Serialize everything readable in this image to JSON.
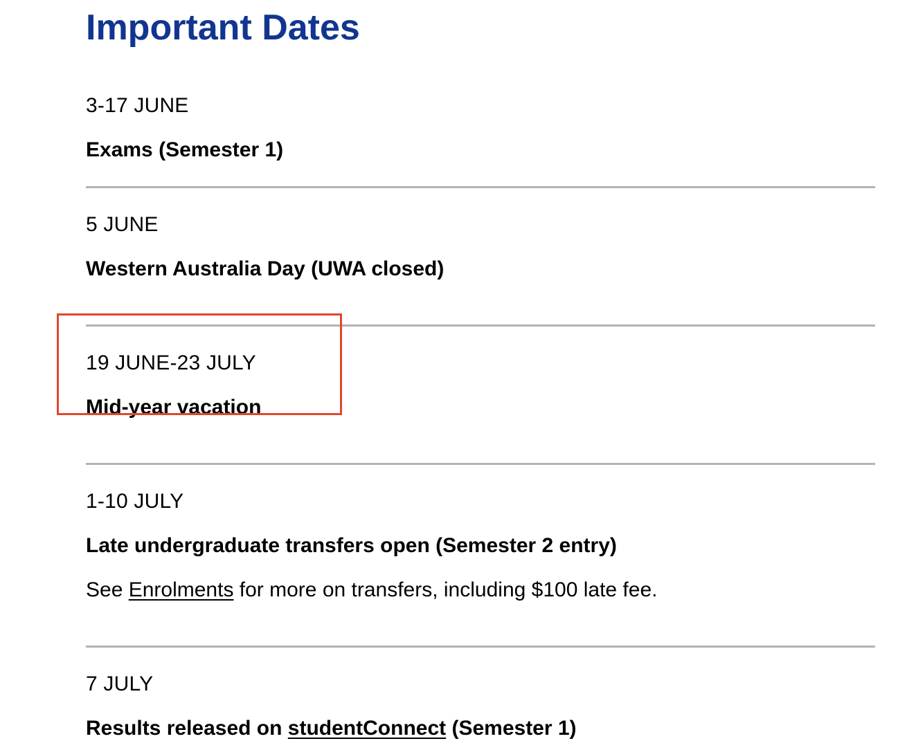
{
  "page": {
    "title": "Important Dates",
    "title_color": "#123590",
    "divider_color": "#b3b3b3",
    "highlight_color": "#e0472f"
  },
  "entries": [
    {
      "date": "3-17 JUNE",
      "event": "Exams (Semester 1)"
    },
    {
      "date": "5 JUNE",
      "event": "Western Australia Day (UWA closed)"
    },
    {
      "date": "19 JUNE-23 JULY",
      "event": "Mid-year vacation",
      "highlighted": true
    },
    {
      "date": "1-10 JULY",
      "event": "Late undergraduate transfers open (Semester 2 entry)",
      "note": {
        "prefix": "See ",
        "link": "Enrolments",
        "suffix": " for more on transfers, including $100 late fee."
      }
    },
    {
      "date": "7 JULY",
      "event": {
        "prefix": "Results released on ",
        "link": "studentConnect",
        "suffix": " (Semester 1)"
      }
    }
  ]
}
